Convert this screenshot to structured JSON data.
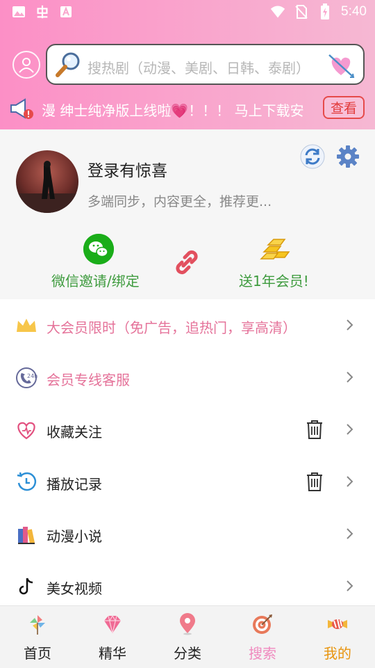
{
  "status_bar": {
    "time": "5:40",
    "left_icons": [
      "image-icon",
      "bug-app-icon",
      "app-a-icon"
    ],
    "right_icons": [
      "wifi-icon",
      "no-sim-icon",
      "battery-charging-icon"
    ]
  },
  "search": {
    "placeholder": "搜热剧（动漫、美剧、日韩、泰剧）"
  },
  "notice": {
    "text": "漫 绅士纯净版上线啦💗！！！ 马上下载安",
    "view_button": "查看"
  },
  "profile": {
    "title": "登录有惊喜",
    "subtitle": "多端同步，内容更全，推荐更...",
    "wechat_label": "微信邀请/绑定",
    "gift_label": "送1年会员!"
  },
  "menu": [
    {
      "label": "大会员限时（免广告，追热门，享高清）",
      "icon": "crown-icon",
      "pink": true
    },
    {
      "label": "会员专线客服",
      "icon": "support-24h-icon",
      "pink": true
    },
    {
      "label": "收藏关注",
      "icon": "heart-outline-icon",
      "trash": true
    },
    {
      "label": "播放记录",
      "icon": "history-icon",
      "trash": true
    },
    {
      "label": "动漫小说",
      "icon": "books-icon"
    },
    {
      "label": "美女视频",
      "icon": "tiktok-icon"
    }
  ],
  "bottom_nav": [
    {
      "label": "首页",
      "icon": "pinwheel-icon"
    },
    {
      "label": "精华",
      "icon": "diamond-icon"
    },
    {
      "label": "分类",
      "icon": "location-pin-icon"
    },
    {
      "label": "搜索",
      "icon": "target-icon",
      "color": "#f08abf"
    },
    {
      "label": "我的",
      "icon": "candy-icon",
      "color": "#e8940e"
    }
  ],
  "colors": {
    "header_gradient_start": "#fc8fc6",
    "header_gradient_end": "#f6b8d3",
    "accent_green": "#3e9b3e",
    "accent_pink": "#e5739a",
    "active_tab_orange": "#e8940e"
  }
}
